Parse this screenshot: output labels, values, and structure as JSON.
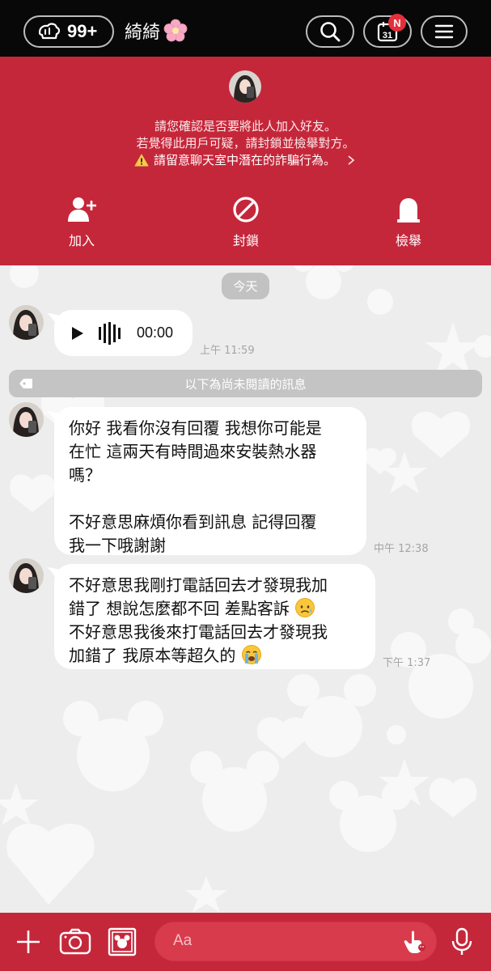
{
  "topbar": {
    "back_count": "99+",
    "chat_name": "綺綺",
    "calendar_date": "31",
    "calendar_badge": "N"
  },
  "notice": {
    "line1": "請您確認是否要將此人加入好友。",
    "line2": "若覺得此用戶可疑，請封鎖並檢舉對方。",
    "warning": "請留意聊天室中潛在的詐騙行為。",
    "actions": {
      "add": "加入",
      "block": "封鎖",
      "report": "檢舉"
    }
  },
  "chat": {
    "date_label": "今天",
    "voice_message": {
      "duration": "00:00",
      "time": "上午 11:59"
    },
    "unread_label": "以下為尚未閱讀的訊息",
    "messages": [
      {
        "lines": [
          "你好 我看你沒有回覆 我想你可能是",
          "在忙 這兩天有時間過來安裝熱水器",
          "嗎？",
          "",
          "不好意思麻煩你看到訊息  記得回覆",
          "我一下哦謝謝"
        ],
        "time": "中午 12:38"
      },
      {
        "lines": [
          "不好意思我剛打電話回去才發現我加",
          "錯了 想說怎麼都不回 差點客訴",
          "不好意思我後來打電話回去才發現我",
          "加錯了 我原本等超久的"
        ],
        "time": "下午 1:37"
      }
    ]
  },
  "composer": {
    "placeholder": "Aa"
  },
  "colors": {
    "brand_red": "#c5273a",
    "topbar_black": "#080808",
    "chat_bg": "#ededed"
  },
  "icons": [
    "friends-back-icon",
    "flower-emoji-icon",
    "search-icon",
    "calendar-icon",
    "menu-icon",
    "add-friend-icon",
    "block-icon",
    "report-icon",
    "warning-icon",
    "chevron-right-icon",
    "play-icon",
    "waveform-icon",
    "sad-emoji-icon",
    "crying-emoji-icon",
    "plus-icon",
    "camera-icon",
    "gallery-icon",
    "emoji-icon",
    "microphone-icon"
  ]
}
